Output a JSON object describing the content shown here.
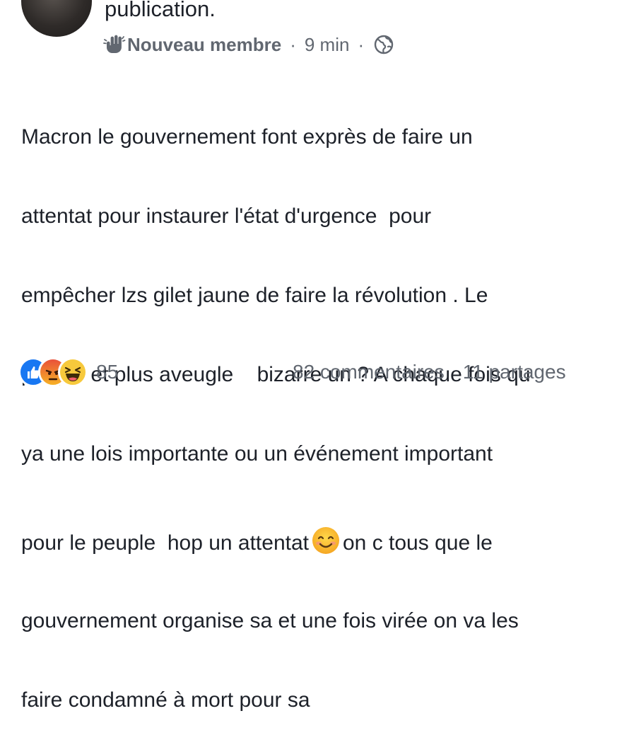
{
  "header": {
    "text": "publication."
  },
  "meta": {
    "badge": "Nouveau membre",
    "sep1": "·",
    "time": "9 min",
    "sep2": "·"
  },
  "post": {
    "lines": [
      "Macron le gouvernement font exprès de faire un",
      "attentat pour instaurer l'état d'urgence  pour",
      "empêcher lzs gilet jaune de faire la révolution . Le",
      "peuple et plus aveugle    bizarre un ? A chaque fois qu",
      "ya une lois importante ou un événement important",
      "pour le peuple  hop un attentat",
      "on c tous que le",
      "gouvernement organise sa et une fois virée on va les",
      "faire condamné à mort pour sa"
    ]
  },
  "reactions": {
    "icons": [
      "like-reaction-icon",
      "angry-reaction-icon",
      "haha-reaction-icon"
    ],
    "count": "85"
  },
  "stats": {
    "comments": "82 commentaires",
    "shares": "11 partages"
  }
}
